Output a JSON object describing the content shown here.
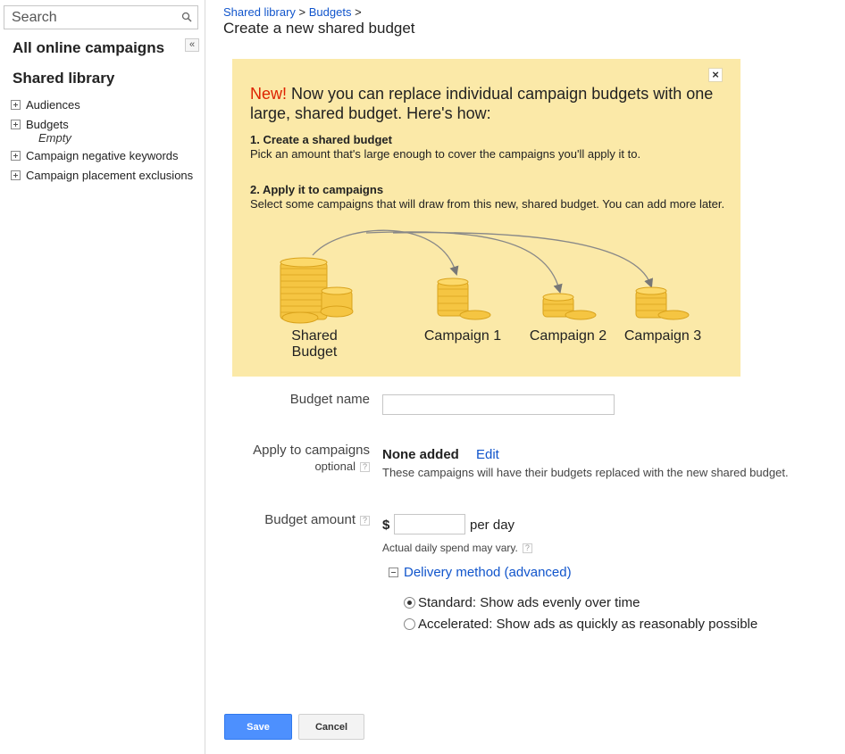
{
  "sidebar": {
    "search_placeholder": "Search",
    "all_campaigns": "All online campaigns",
    "collapse_glyph": "«",
    "shared_library": "Shared library",
    "items": [
      {
        "label": "Audiences"
      },
      {
        "label": "Budgets",
        "sublabel": "Empty"
      },
      {
        "label": "Campaign negative keywords"
      },
      {
        "label": "Campaign placement exclusions"
      }
    ]
  },
  "breadcrumb": {
    "item1": "Shared library",
    "sep1": " > ",
    "item2": "Budgets",
    "sep2": " >"
  },
  "page_title": "Create a new shared budget",
  "promo": {
    "close": "×",
    "new_label": "New!",
    "headline": " Now you can replace individual campaign budgets with one large, shared budget. Here's how:",
    "step1_title": "1. Create a shared budget",
    "step1_text": "Pick an amount that's large enough to cover the campaigns you'll apply it to.",
    "step2_title": "2. Apply it to campaigns",
    "step2_text": "Select some campaigns that will draw from this new, shared budget. You can add more later.",
    "labels": {
      "shared_line1": "Shared",
      "shared_line2": "Budget",
      "campaign1": "Campaign 1",
      "campaign2": "Campaign 2",
      "campaign3": "Campaign 3"
    }
  },
  "form": {
    "budget_name_label": "Budget name",
    "budget_name_value": "",
    "apply_label": "Apply to campaigns",
    "optional_label": "optional",
    "help_glyph": "?",
    "none_added": "None added",
    "edit": "Edit",
    "campaigns_note": "These campaigns will have their budgets replaced with the new shared budget.",
    "amount_label": "Budget amount",
    "currency": "$",
    "amount_value": "",
    "per_day": "per day",
    "spend_note": "Actual daily spend may vary.",
    "delivery_label": "Delivery method (advanced)",
    "delivery_options": [
      {
        "label": "Standard: Show ads evenly over time",
        "checked": true
      },
      {
        "label": "Accelerated: Show ads as quickly as reasonably possible",
        "checked": false
      }
    ]
  },
  "buttons": {
    "save": "Save",
    "cancel": "Cancel"
  },
  "colors": {
    "link": "#1155cc",
    "promo_bg": "#fbe9a8",
    "new_red": "#dd2200",
    "save_blue": "#4d90fe",
    "coin_gold": "#f5c542"
  }
}
